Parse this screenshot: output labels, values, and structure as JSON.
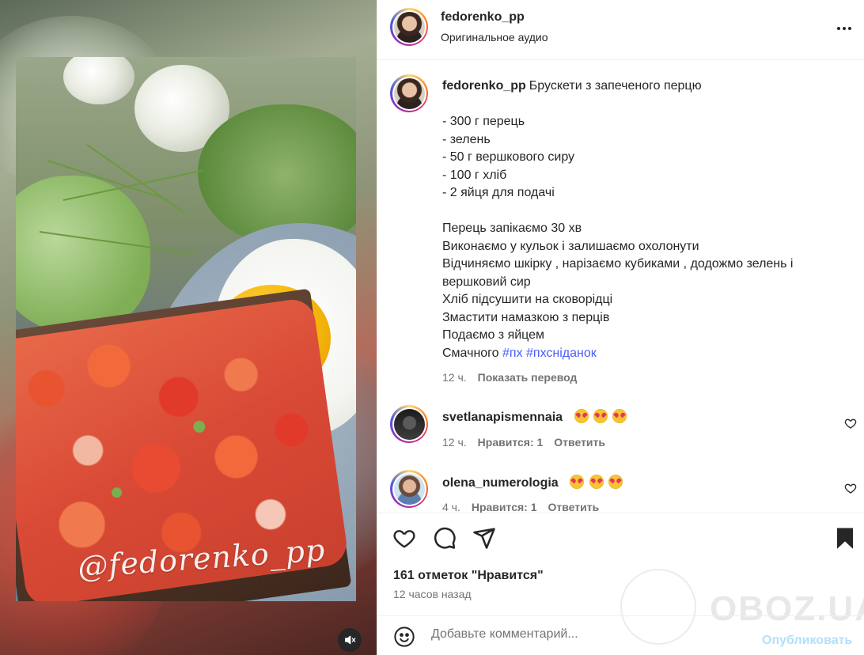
{
  "post": {
    "author": "fedorenko_pp",
    "audio": "Оригинальное аудио",
    "watermark": "@fedorenko_pp",
    "caption": {
      "title": "Брускети з запеченого перцю",
      "lines": [
        "- 300 г перець",
        "- зелень",
        "- 50 г вершкового сиру",
        "- 100 г хліб",
        "- 2 яйця для подачі",
        "",
        "Перець запікаємо 30 хв",
        "Виконаємо у кульок і залишаємо охолонути",
        "Відчиняємо шкірку , нарізаємо кубиками , додожмо зелень і",
        "вершковий сир",
        "Хліб підсушити на сковорідці",
        "Змастити намазкою з перців",
        "Подаємо з яйцем"
      ],
      "last_line_text": "Смачного",
      "hashtags": [
        "#пх",
        "#пхсніданок"
      ],
      "time": "12 ч.",
      "translate": "Показать перевод"
    },
    "likes": "161 отметок \"Нравится\"",
    "time_ago": "12 часов назад"
  },
  "comments": [
    {
      "username": "svetlanapismennaia",
      "emoji_count": 3,
      "time": "12 ч.",
      "likes": "Нравится: 1",
      "reply": "Ответить"
    },
    {
      "username": "olena_numerologia",
      "emoji_count": 3,
      "time": "4 ч.",
      "likes": "Нравится: 1",
      "reply": "Ответить"
    }
  ],
  "composer": {
    "placeholder": "Добавьте комментарий...",
    "publish": "Опубликовать"
  },
  "overlay": {
    "brand": "OBOZ.UA"
  },
  "icons": {
    "more": "more-options-icon",
    "mute": "muted-speaker-icon",
    "like": "heart-icon",
    "comment": "comment-bubble-icon",
    "share": "paper-plane-icon",
    "save": "bookmark-icon",
    "emoji": "smiley-icon"
  },
  "colors": {
    "text": "#262626",
    "muted": "#737373",
    "hashtag": "#4a5df9",
    "publish_disabled": "#b2dffc"
  }
}
